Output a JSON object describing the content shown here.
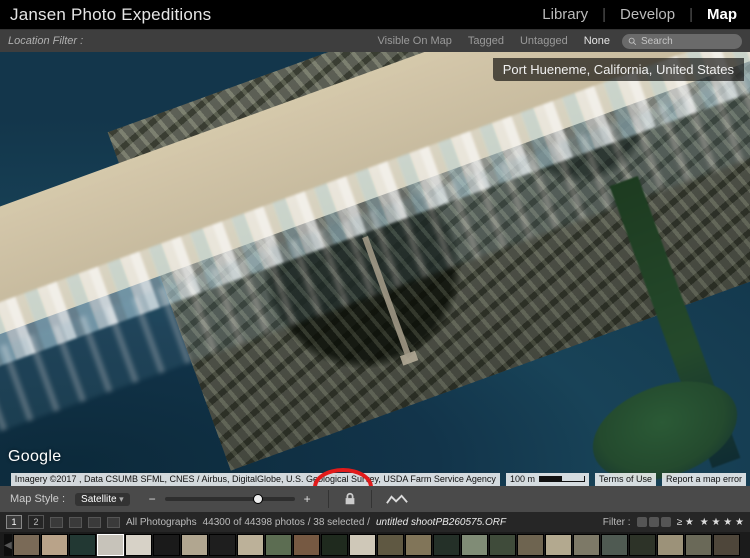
{
  "topbar": {
    "brand": "Jansen Photo Expeditions",
    "modules": {
      "library": "Library",
      "develop": "Develop",
      "map": "Map"
    }
  },
  "filterbar": {
    "label": "Location Filter :",
    "visible": "Visible On Map",
    "tagged": "Tagged",
    "untagged": "Untagged",
    "none": "None",
    "search_placeholder": "Search"
  },
  "map": {
    "location_name": "Port Hueneme, California, United States",
    "provider": "Google",
    "attribution": "Imagery ©2017 , Data CSUMB SFML, CNES / Airbus, DigitalGlobe, U.S. Geological Survey, USDA Farm Service Agency",
    "scale_label": "100 m",
    "terms": "Terms of Use",
    "report": "Report a map error"
  },
  "mapstyle": {
    "label": "Map Style :",
    "value": "Satellite"
  },
  "infobar": {
    "page1": "1",
    "page2": "2",
    "collection": "All Photographs",
    "counts": "44300 of 44398 photos / 38 selected /",
    "filename": "untitled shootPB260575.ORF",
    "filter_label": "Filter :",
    "star_glyph": "≥ ★"
  },
  "thumb_colors": [
    "#7a6a57",
    "#b9a389",
    "#223833",
    "#c7c3ba",
    "#d7d2c7",
    "#1a1a1a",
    "#b1a690",
    "#1e1e1e",
    "#bcb199",
    "#5c6d52",
    "#765942",
    "#1f2a1e",
    "#cfc8b8",
    "#5f5842",
    "#817559",
    "#243028",
    "#808c76",
    "#3f4b3a",
    "#6e6450",
    "#b3a98f",
    "#7d7967",
    "#4f5a52",
    "#2d3328",
    "#9c9279",
    "#6a6958",
    "#4e463a"
  ]
}
